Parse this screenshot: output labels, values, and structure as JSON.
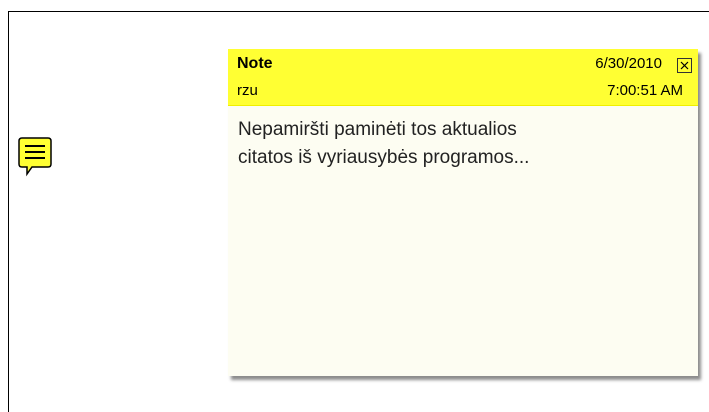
{
  "annotation_icon": {
    "icon": "speech-bubble-note-icon",
    "fill_color": "#ffff33",
    "stroke_color": "#000000"
  },
  "note": {
    "title": "Note",
    "author": "rzu",
    "date": "6/30/2010",
    "time": "7:00:51 AM",
    "close_icon": "close-x-icon",
    "body": "Nepamiršti paminėti tos aktualios\ncitatos iš vyriausybės programos...",
    "header_color": "#ffff33",
    "body_color": "#fdfdf2"
  }
}
